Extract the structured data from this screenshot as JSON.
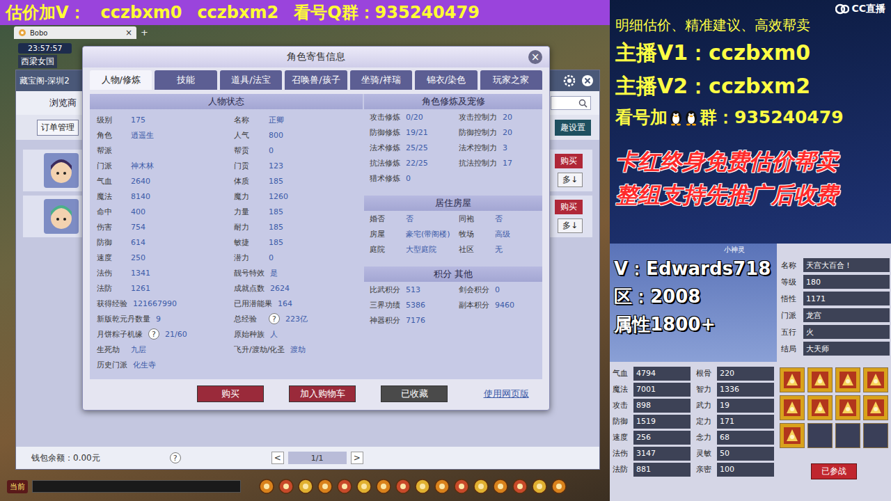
{
  "banner": {
    "items": [
      "估价加V：",
      "cczbxm0",
      "cczbxm2",
      "看号Q群：935240479"
    ]
  },
  "client": {
    "tab": "Bobo",
    "tab_close": "×",
    "tab_add": "+",
    "time": "23:57:57",
    "location": "西梁女国",
    "chat_channel": "当前"
  },
  "shop": {
    "title": "藏宝阁-深圳2",
    "nav": "浏览商",
    "order_button": "订单管理",
    "settings_button": "趣设置",
    "listings": [
      {
        "buy": "购买",
        "more": "多↓"
      },
      {
        "buy": "购买",
        "more": "多↓"
      }
    ],
    "wallet": "钱包余额：0.00元",
    "help": "?",
    "pager": {
      "prev": "<",
      "page": "1/1",
      "next": ">"
    }
  },
  "dialog": {
    "title": "角色寄售信息",
    "close": "×",
    "tabs": [
      {
        "label": "人物/修炼",
        "selected": true
      },
      {
        "label": "技能",
        "selected": false
      },
      {
        "label": "道具/法宝",
        "selected": false
      },
      {
        "label": "召唤兽/孩子",
        "selected": false
      },
      {
        "label": "坐骑/祥瑞",
        "selected": false
      },
      {
        "label": "锦衣/染色",
        "selected": false
      },
      {
        "label": "玩家之家",
        "selected": false
      }
    ],
    "status": {
      "title": "人物状态",
      "left": [
        {
          "label": "级别",
          "value": "175"
        },
        {
          "label": "角色",
          "value": "逍遥生"
        },
        {
          "label": "帮派",
          "value": ""
        },
        {
          "label": "门派",
          "value": "神木林"
        },
        {
          "label": "气血",
          "value": "2640"
        },
        {
          "label": "魔法",
          "value": "8140"
        },
        {
          "label": "命中",
          "value": "400"
        },
        {
          "label": "伤害",
          "value": "754"
        },
        {
          "label": "防御",
          "value": "614"
        },
        {
          "label": "速度",
          "value": "250"
        },
        {
          "label": "法伤",
          "value": "1341"
        },
        {
          "label": "法防",
          "value": "1261"
        },
        {
          "label": "获得经验",
          "value": "121667990"
        },
        {
          "label": "新版乾元丹数量",
          "value": "9"
        },
        {
          "label": "月饼粽子机缘",
          "help": "?",
          "value": "21/60"
        },
        {
          "label": "生死劫",
          "value": "九层"
        },
        {
          "label": "历史门派",
          "value": "化生寺"
        }
      ],
      "right": [
        {
          "label": "名称",
          "value": "正卿"
        },
        {
          "label": "人气",
          "value": "800"
        },
        {
          "label": "帮贡",
          "value": "0"
        },
        {
          "label": "门贡",
          "value": "123"
        },
        {
          "label": "体质",
          "value": "185"
        },
        {
          "label": "魔力",
          "value": "1260"
        },
        {
          "label": "力量",
          "value": "185"
        },
        {
          "label": "耐力",
          "value": "185"
        },
        {
          "label": "敏捷",
          "value": "185"
        },
        {
          "label": "潜力",
          "value": "0"
        },
        {
          "label": "靓号特效",
          "value": "是"
        },
        {
          "label": "成就点数",
          "value": "2624"
        },
        {
          "label": "已用潜能果",
          "value": "164"
        },
        {
          "label": "总经验",
          "help": "?",
          "value": "223亿"
        },
        {
          "label": "原始种族",
          "value": "人"
        },
        {
          "label": "飞升/渡劫/化圣",
          "value": "渡劫"
        }
      ]
    },
    "sections": [
      {
        "title": "角色修炼及宠修",
        "rows": [
          [
            {
              "label": "攻击修炼",
              "value": "0/20"
            },
            {
              "label": "攻击控制力",
              "value": "20"
            }
          ],
          [
            {
              "label": "防御修炼",
              "value": "19/21"
            },
            {
              "label": "防御控制力",
              "value": "20"
            }
          ],
          [
            {
              "label": "法术修炼",
              "value": "25/25"
            },
            {
              "label": "法术控制力",
              "value": "3"
            }
          ],
          [
            {
              "label": "抗法修炼",
              "value": "22/25"
            },
            {
              "label": "抗法控制力",
              "value": "17"
            }
          ],
          [
            {
              "label": "猎术修炼",
              "value": "0"
            }
          ]
        ]
      },
      {
        "title": "居住房屋",
        "rows": [
          [
            {
              "label": "婚否",
              "value": "否"
            },
            {
              "label": "同袍",
              "value": "否"
            }
          ],
          [
            {
              "label": "房屋",
              "value": "豪宅(带阁楼)"
            },
            {
              "label": "牧场",
              "value": "高级"
            }
          ],
          [
            {
              "label": "庭院",
              "value": "大型庭院"
            },
            {
              "label": "社区",
              "value": "无"
            }
          ]
        ]
      },
      {
        "title": "积分 其他",
        "rows": [
          [
            {
              "label": "比武积分",
              "value": "513"
            },
            {
              "label": "剑会积分",
              "value": "0"
            }
          ],
          [
            {
              "label": "三界功绩",
              "value": "5386"
            },
            {
              "label": "副本积分",
              "value": "9460"
            }
          ],
          [
            {
              "label": "神器积分",
              "value": "7176"
            }
          ]
        ]
      }
    ],
    "buttons": [
      {
        "label": "购买",
        "kind": "primary"
      },
      {
        "label": "加入购物车",
        "kind": "primary"
      },
      {
        "label": "已收藏",
        "kind": "muted"
      },
      {
        "label": "使用网页版",
        "kind": "link"
      }
    ]
  },
  "stream": {
    "logo": "CC直播",
    "tagline": "明细估价、精准建议、高效帮卖",
    "contacts": [
      "主播V1：cczbxm0",
      "主播V2：cczbxm2"
    ],
    "group": {
      "prefix": "看号加",
      "suffix": "群：935240479"
    },
    "promos": [
      "卡红终身免费估价帮卖",
      "整组支持先推广后收费"
    ],
    "seller": [
      "V：Edwards718",
      "区：2008",
      "属性1800+"
    ]
  },
  "pet": {
    "sprite_label": "小神灵",
    "info": [
      {
        "label": "名称",
        "value": "天宫大百合！"
      },
      {
        "label": "等级",
        "value": "180"
      },
      {
        "label": "悟性",
        "value": "1171"
      },
      {
        "label": "门派",
        "value": "龙宫"
      },
      {
        "label": "五行",
        "value": "火"
      },
      {
        "label": "结局",
        "value": "大天师"
      }
    ],
    "stats": [
      {
        "label": "气血",
        "value": "4794"
      },
      {
        "label": "根骨",
        "value": "220"
      },
      {
        "label": "魔法",
        "value": "7001"
      },
      {
        "label": "智力",
        "value": "1336"
      },
      {
        "label": "攻击",
        "value": "898"
      },
      {
        "label": "武力",
        "value": "19"
      },
      {
        "label": "防御",
        "value": "1519"
      },
      {
        "label": "定力",
        "value": "171"
      },
      {
        "label": "速度",
        "value": "256"
      },
      {
        "label": "念力",
        "value": "68"
      },
      {
        "label": "法伤",
        "value": "3147"
      },
      {
        "label": "灵敏",
        "value": "50"
      },
      {
        "label": "法防",
        "value": "881"
      },
      {
        "label": "亲密",
        "value": "100"
      }
    ],
    "skills": [
      {
        "filled": true
      },
      {
        "filled": true
      },
      {
        "filled": true
      },
      {
        "filled": true
      },
      {
        "filled": true
      },
      {
        "filled": true
      },
      {
        "filled": true
      },
      {
        "filled": true
      },
      {
        "filled": true
      },
      {
        "filled": false
      },
      {
        "filled": false
      },
      {
        "filled": false
      }
    ],
    "status_button": "已参战"
  }
}
